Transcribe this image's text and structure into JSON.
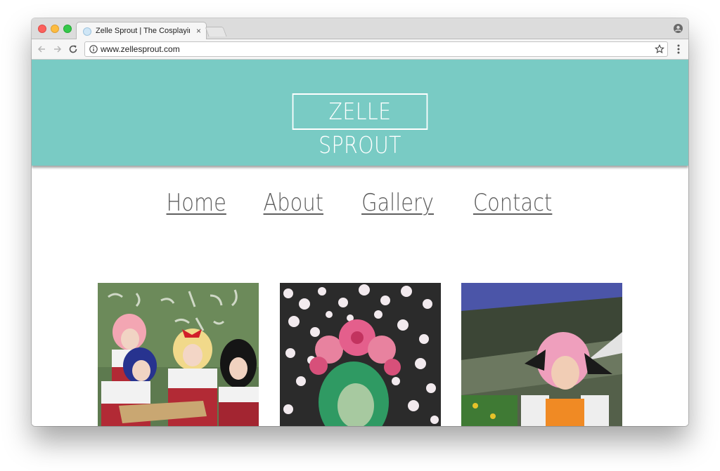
{
  "browser": {
    "tab_title": "Zelle Sprout | The Cosplaying",
    "tab_close": "×",
    "url": "www.zellesprout.com"
  },
  "site": {
    "logo": "ZELLE SPROUT",
    "nav": [
      "Home",
      "About",
      "Gallery",
      "Contact"
    ],
    "hero_color": "#79cbc4"
  },
  "gallery": {
    "photos": [
      {
        "subject": "four-cosplayers-school-uniforms"
      },
      {
        "subject": "green-hair-flower-crown"
      },
      {
        "subject": "pink-hair-cat-ears"
      }
    ]
  },
  "icons": {
    "traffic_lights": [
      "close-icon",
      "minimize-icon",
      "zoom-icon"
    ],
    "toolbar": [
      "back-arrow-icon",
      "forward-arrow-icon",
      "reload-icon",
      "info-icon",
      "star-icon",
      "menu-icon",
      "profile-icon"
    ]
  }
}
